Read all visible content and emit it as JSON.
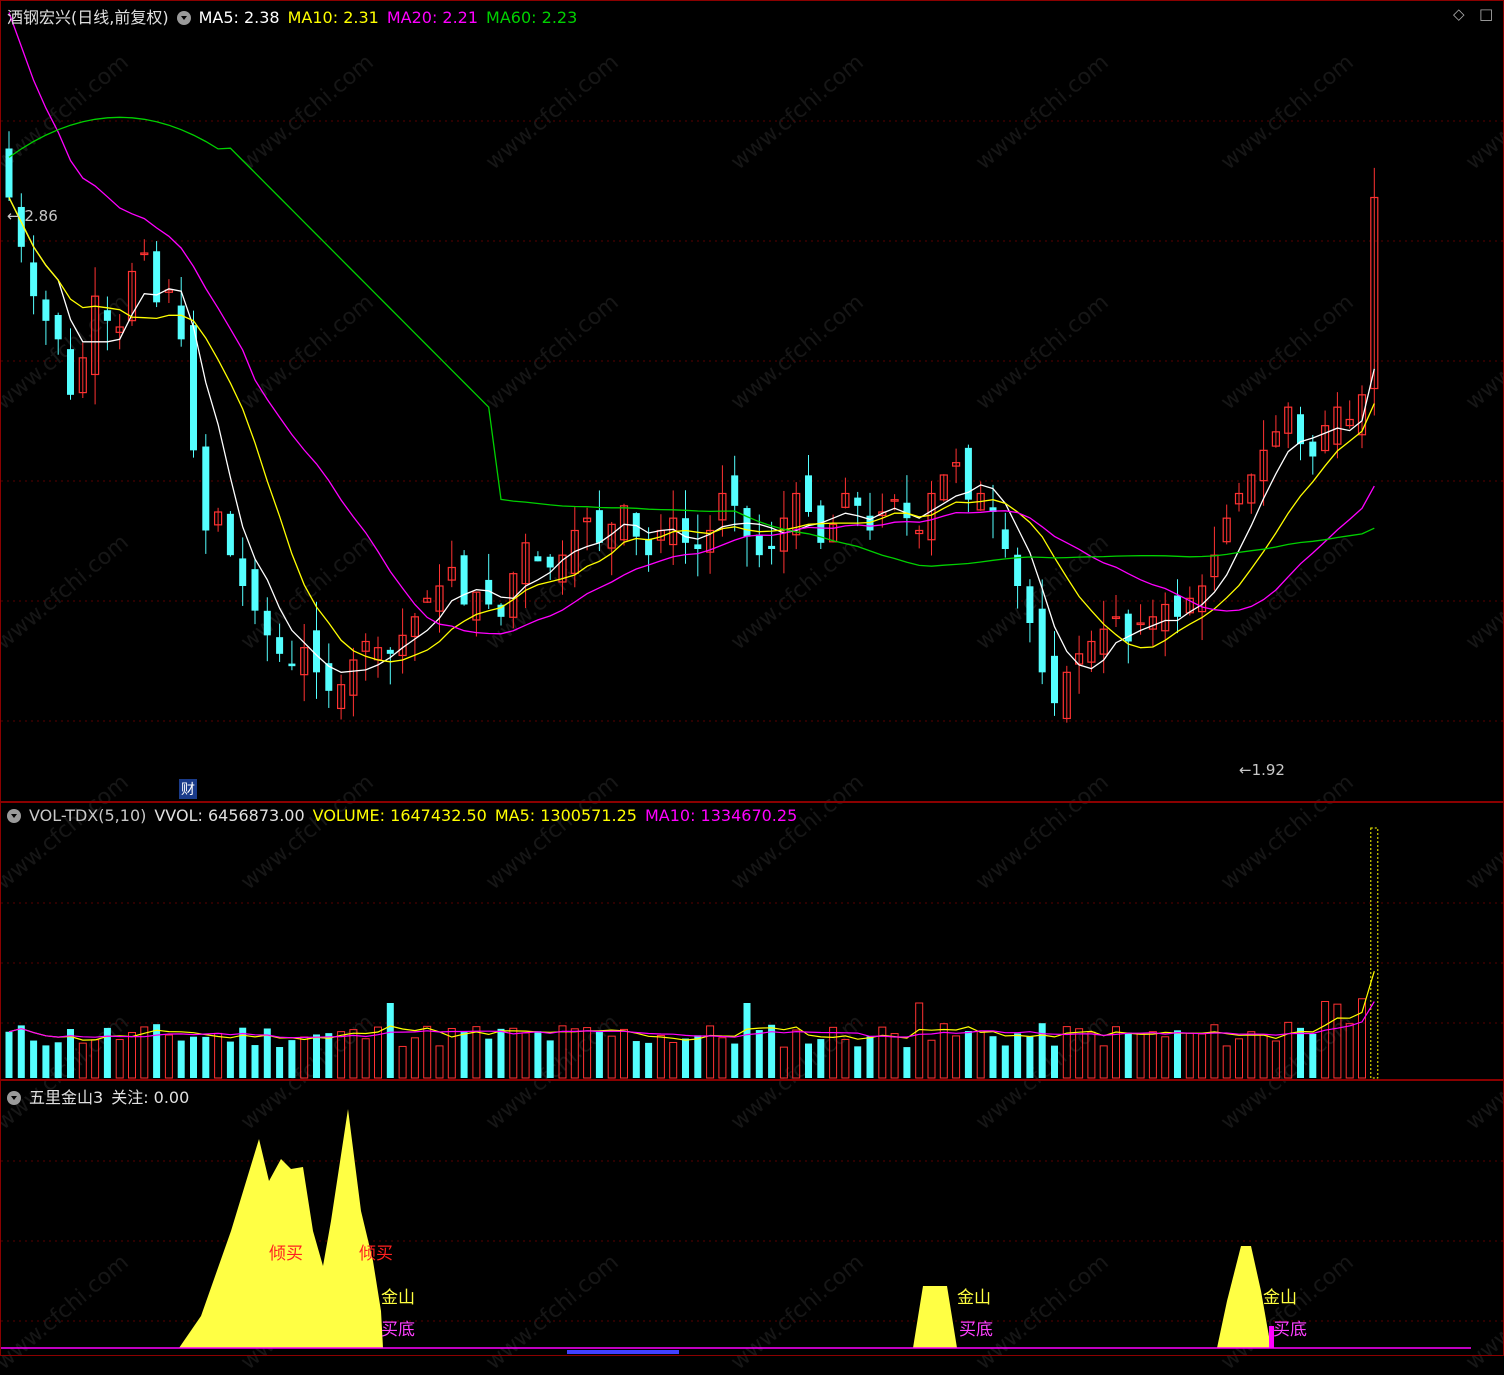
{
  "price_header": {
    "stock": "酒钢宏兴(日线,前复权)",
    "ma5": "MA5: 2.38",
    "ma10": "MA10: 2.31",
    "ma20": "MA20: 2.21",
    "ma60": "MA60: 2.23"
  },
  "high_label": "← 2.86",
  "low_label": "←1.92",
  "fin_badge": "财",
  "vol_header": {
    "name": "VOL-TDX(5,10)",
    "vvol": "VVOL: 6456873.00",
    "volume": "VOLUME: 1647432.50",
    "ma5": "MA5: 1300571.25",
    "ma10": "MA10: 1334670.25"
  },
  "ind_header": {
    "name": "五里金山3",
    "focus": "关注: 0.00"
  },
  "signals": {
    "qingmai": "倾买",
    "jinshan": "金山",
    "maidi": "买底"
  },
  "watermark": "www.cfchi.com",
  "corner_icons": [
    "diamond-icon",
    "square-icon"
  ],
  "colors": {
    "up": "#ff3232",
    "down": "#54ffff",
    "ma5": "#ffffff",
    "ma10": "#ffff00",
    "ma20": "#ff00ff",
    "ma60": "#00d000",
    "fill": "#ffff44"
  },
  "chart_data": {
    "type": "candlestick",
    "price_range": [
      1.85,
      3.05
    ],
    "closes": [
      2.78,
      2.7,
      2.62,
      2.58,
      2.55,
      2.46,
      2.52,
      2.62,
      2.58,
      2.57,
      2.66,
      2.69,
      2.61,
      2.63,
      2.55,
      2.37,
      2.24,
      2.27,
      2.2,
      2.15,
      2.11,
      2.07,
      2.04,
      2.02,
      2.05,
      2.01,
      1.98,
      1.99,
      2.03,
      2.06,
      2.05,
      2.04,
      2.07,
      2.1,
      2.13,
      2.15,
      2.18,
      2.12,
      2.14,
      2.12,
      2.1,
      2.17,
      2.22,
      2.19,
      2.18,
      2.2,
      2.24,
      2.26,
      2.22,
      2.25,
      2.28,
      2.23,
      2.2,
      2.24,
      2.26,
      2.22,
      2.21,
      2.24,
      2.3,
      2.28,
      2.23,
      2.2,
      2.21,
      2.26,
      2.3,
      2.27,
      2.22,
      2.25,
      2.3,
      2.28,
      2.24,
      2.27,
      2.29,
      2.26,
      2.24,
      2.3,
      2.33,
      2.35,
      2.29,
      2.3,
      2.27,
      2.21,
      2.15,
      2.09,
      2.01,
      1.96,
      2.01,
      2.04,
      2.06,
      2.08,
      2.1,
      2.06,
      2.09,
      2.1,
      2.12,
      2.1,
      2.13,
      2.15,
      2.2,
      2.26,
      2.3,
      2.33,
      2.37,
      2.4,
      2.44,
      2.38,
      2.36,
      2.41,
      2.44,
      2.42,
      2.46,
      2.78
    ],
    "volume_labels": "VOL-TDX(5,10)",
    "indicator": "五里金山3"
  }
}
